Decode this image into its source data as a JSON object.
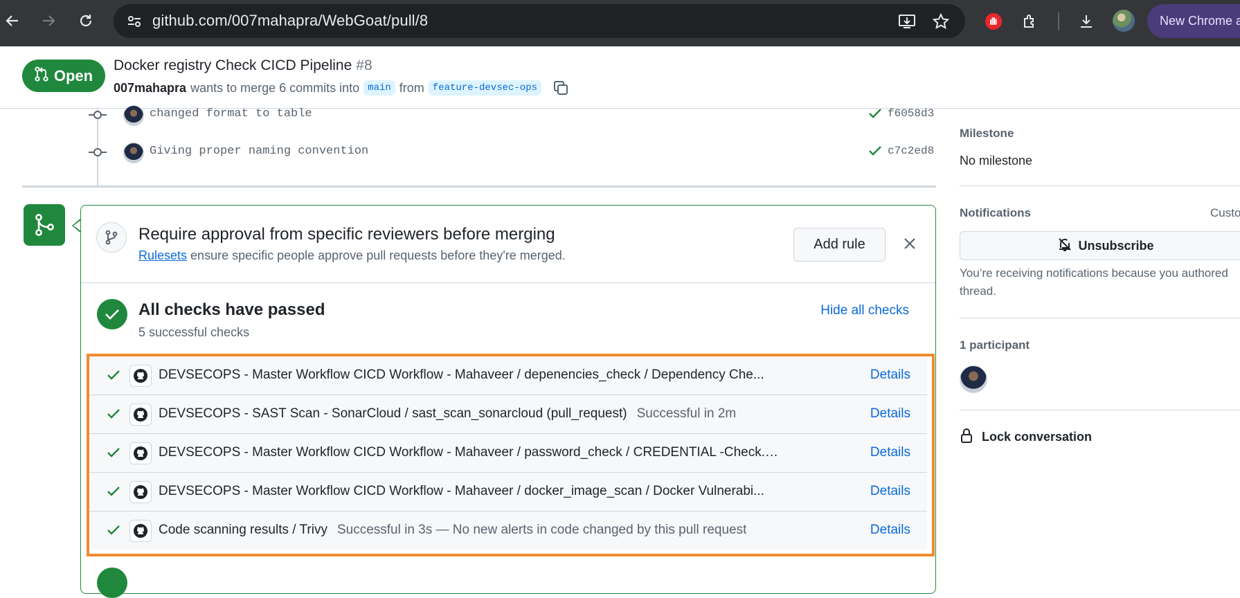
{
  "browser": {
    "url": "github.com/007mahapra/WebGoat/pull/8",
    "profile_label": "New Chrome a"
  },
  "pr": {
    "state_label": "Open",
    "title": "Docker registry Check CICD Pipeline",
    "number": "#8",
    "author": "007mahapra",
    "merge_text": "wants to merge 6 commits into",
    "base_branch": "main",
    "from_text": "from",
    "head_branch": "feature-devsec-ops"
  },
  "commits": [
    {
      "message": "changed format to table",
      "sha": "f6058d3"
    },
    {
      "message": "Giving proper naming convention",
      "sha": "c7c2ed8"
    }
  ],
  "ruleset": {
    "title": "Require approval from specific reviewers before merging",
    "link": "Rulesets",
    "desc": "ensure specific people approve pull requests before they're merged.",
    "add_rule": "Add rule"
  },
  "checks": {
    "title": "All checks have passed",
    "subtitle": "5 successful checks",
    "hide_label": "Hide all checks",
    "details_label": "Details",
    "items": [
      {
        "name": "DEVSECOPS - Master Workflow CICD Workflow - Mahaveer / depenencies_check / Dependency Che...",
        "status": ""
      },
      {
        "name": "DEVSECOPS - SAST Scan - SonarCloud / sast_scan_sonarcloud (pull_request)",
        "status": "Successful in 2m"
      },
      {
        "name": "DEVSECOPS - Master Workflow CICD Workflow - Mahaveer / password_check / CREDENTIAL -Check...",
        "status": ""
      },
      {
        "name": "DEVSECOPS - Master Workflow CICD Workflow - Mahaveer / docker_image_scan / Docker Vulnerabi...",
        "status": ""
      },
      {
        "name": "Code scanning results / Trivy",
        "status": "Successful in 3s — No new alerts in code changed by this pull request"
      }
    ]
  },
  "sidebar": {
    "milestone_heading": "Milestone",
    "milestone_value": "No milestone",
    "notifications_heading": "Notifications",
    "customize_label": "Custo",
    "unsubscribe_label": "Unsubscribe",
    "notify_note_1": "You’re receiving notifications because you authored",
    "notify_note_2": "thread.",
    "participants_heading": "1 participant",
    "lock_label": "Lock conversation"
  },
  "colors": {
    "success": "#1f883d",
    "link": "#0969da",
    "highlight": "#f28a2e"
  }
}
